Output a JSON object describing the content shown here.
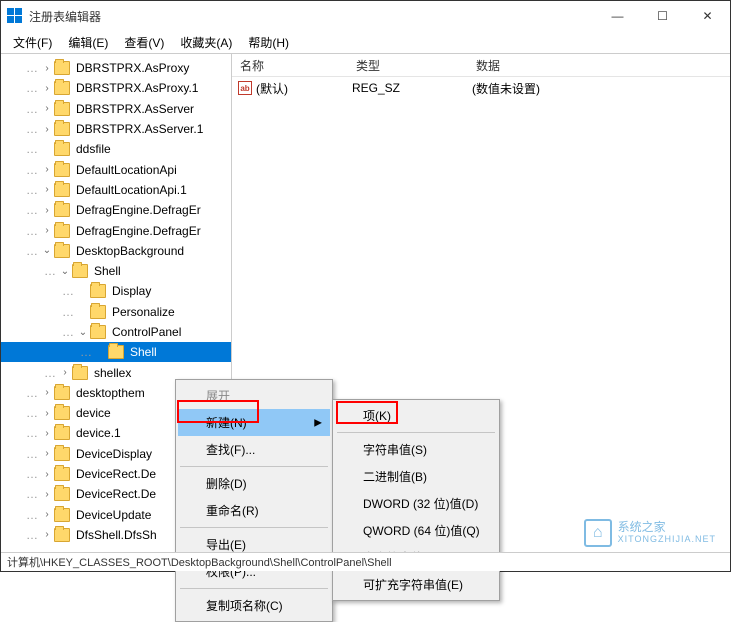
{
  "window": {
    "title": "注册表编辑器"
  },
  "menubar": [
    "文件(F)",
    "编辑(E)",
    "查看(V)",
    "收藏夹(A)",
    "帮助(H)"
  ],
  "tree": [
    {
      "depth": 1,
      "arrow": ">",
      "label": "DBRSTPRX.AsProxy"
    },
    {
      "depth": 1,
      "arrow": ">",
      "label": "DBRSTPRX.AsProxy.1"
    },
    {
      "depth": 1,
      "arrow": ">",
      "label": "DBRSTPRX.AsServer"
    },
    {
      "depth": 1,
      "arrow": ">",
      "label": "DBRSTPRX.AsServer.1"
    },
    {
      "depth": 1,
      "arrow": "",
      "label": "ddsfile"
    },
    {
      "depth": 1,
      "arrow": ">",
      "label": "DefaultLocationApi"
    },
    {
      "depth": 1,
      "arrow": ">",
      "label": "DefaultLocationApi.1"
    },
    {
      "depth": 1,
      "arrow": ">",
      "label": "DefragEngine.DefragEr"
    },
    {
      "depth": 1,
      "arrow": ">",
      "label": "DefragEngine.DefragEr"
    },
    {
      "depth": 1,
      "arrow": "v",
      "label": "DesktopBackground"
    },
    {
      "depth": 2,
      "arrow": "v",
      "label": "Shell"
    },
    {
      "depth": 3,
      "arrow": "",
      "label": "Display"
    },
    {
      "depth": 3,
      "arrow": "",
      "label": "Personalize"
    },
    {
      "depth": 3,
      "arrow": "v",
      "label": "ControlPanel"
    },
    {
      "depth": 4,
      "arrow": "",
      "label": "Shell",
      "selected": true
    },
    {
      "depth": 2,
      "arrow": ">",
      "label": "shellex"
    },
    {
      "depth": 1,
      "arrow": ">",
      "label": "desktopthem"
    },
    {
      "depth": 1,
      "arrow": ">",
      "label": "device"
    },
    {
      "depth": 1,
      "arrow": ">",
      "label": "device.1"
    },
    {
      "depth": 1,
      "arrow": ">",
      "label": "DeviceDisplay"
    },
    {
      "depth": 1,
      "arrow": ">",
      "label": "DeviceRect.De"
    },
    {
      "depth": 1,
      "arrow": ">",
      "label": "DeviceRect.De"
    },
    {
      "depth": 1,
      "arrow": ">",
      "label": "DeviceUpdate"
    },
    {
      "depth": 1,
      "arrow": ">",
      "label": "DfsShell.DfsSh"
    }
  ],
  "list": {
    "headers": [
      "名称",
      "类型",
      "数据"
    ],
    "rows": [
      {
        "icon": "ab",
        "name": "(默认)",
        "type": "REG_SZ",
        "data": "(数值未设置)"
      }
    ]
  },
  "context_menu_1": [
    {
      "label": "展开",
      "disabled": true
    },
    {
      "label": "新建(N)",
      "hover": true,
      "submenu": true
    },
    {
      "label": "查找(F)..."
    },
    {
      "sep": true
    },
    {
      "label": "删除(D)"
    },
    {
      "label": "重命名(R)"
    },
    {
      "sep": true
    },
    {
      "label": "导出(E)"
    },
    {
      "label": "权限(P)..."
    },
    {
      "sep": true
    },
    {
      "label": "复制项名称(C)"
    }
  ],
  "context_menu_2": [
    {
      "label": "项(K)"
    },
    {
      "sep": true
    },
    {
      "label": "字符串值(S)"
    },
    {
      "label": "二进制值(B)"
    },
    {
      "label": "DWORD (32 位)值(D)"
    },
    {
      "label": "QWORD (64 位)值(Q)"
    },
    {
      "label": "多字符串值(M)"
    },
    {
      "label": "可扩充字符串值(E)"
    }
  ],
  "statusbar": "计算机\\HKEY_CLASSES_ROOT\\DesktopBackground\\Shell\\ControlPanel\\Shell",
  "watermark": {
    "line1": "系统之家",
    "line2": "XITONGZHIJIA.NET"
  },
  "win_icons": {
    "min": "—",
    "max": "☐",
    "close": "✕"
  }
}
